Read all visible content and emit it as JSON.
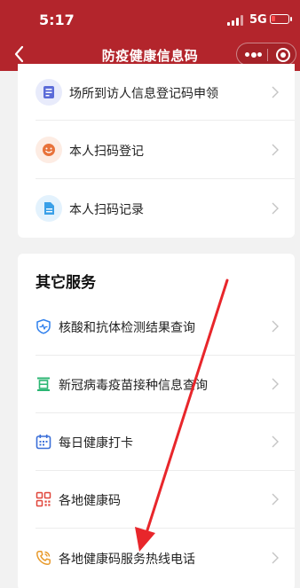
{
  "status_bar": {
    "time": "5:17",
    "network": "5G"
  },
  "nav": {
    "title": "防疫健康信息码"
  },
  "card1": {
    "items": [
      {
        "label": "场所到访人信息登记码申领",
        "icon": "form-doc-icon",
        "color": "#5b6bd8",
        "bg": "#e8ebfb"
      },
      {
        "label": "本人扫码登记",
        "icon": "smiley-face-icon",
        "color": "#e8733b",
        "bg": "#fdece3"
      },
      {
        "label": "本人扫码记录",
        "icon": "document-icon",
        "color": "#3aa0e8",
        "bg": "#e3f2fd"
      }
    ]
  },
  "card2": {
    "title": "其它服务",
    "items": [
      {
        "label": "核酸和抗体检测结果查询",
        "icon": "shield-pulse-icon",
        "color": "#2f80ed"
      },
      {
        "label": "新冠病毒疫苗接种信息查询",
        "icon": "vaccine-icon",
        "color": "#2bb673"
      },
      {
        "label": "每日健康打卡",
        "icon": "calendar-icon",
        "color": "#3b6fd8"
      },
      {
        "label": "各地健康码",
        "icon": "qr-code-icon",
        "color": "#e0453a"
      },
      {
        "label": "各地健康码服务热线电话",
        "icon": "phone-icon",
        "color": "#e89a2b"
      }
    ]
  },
  "annotation": {
    "arrow_color": "#e8262b"
  }
}
